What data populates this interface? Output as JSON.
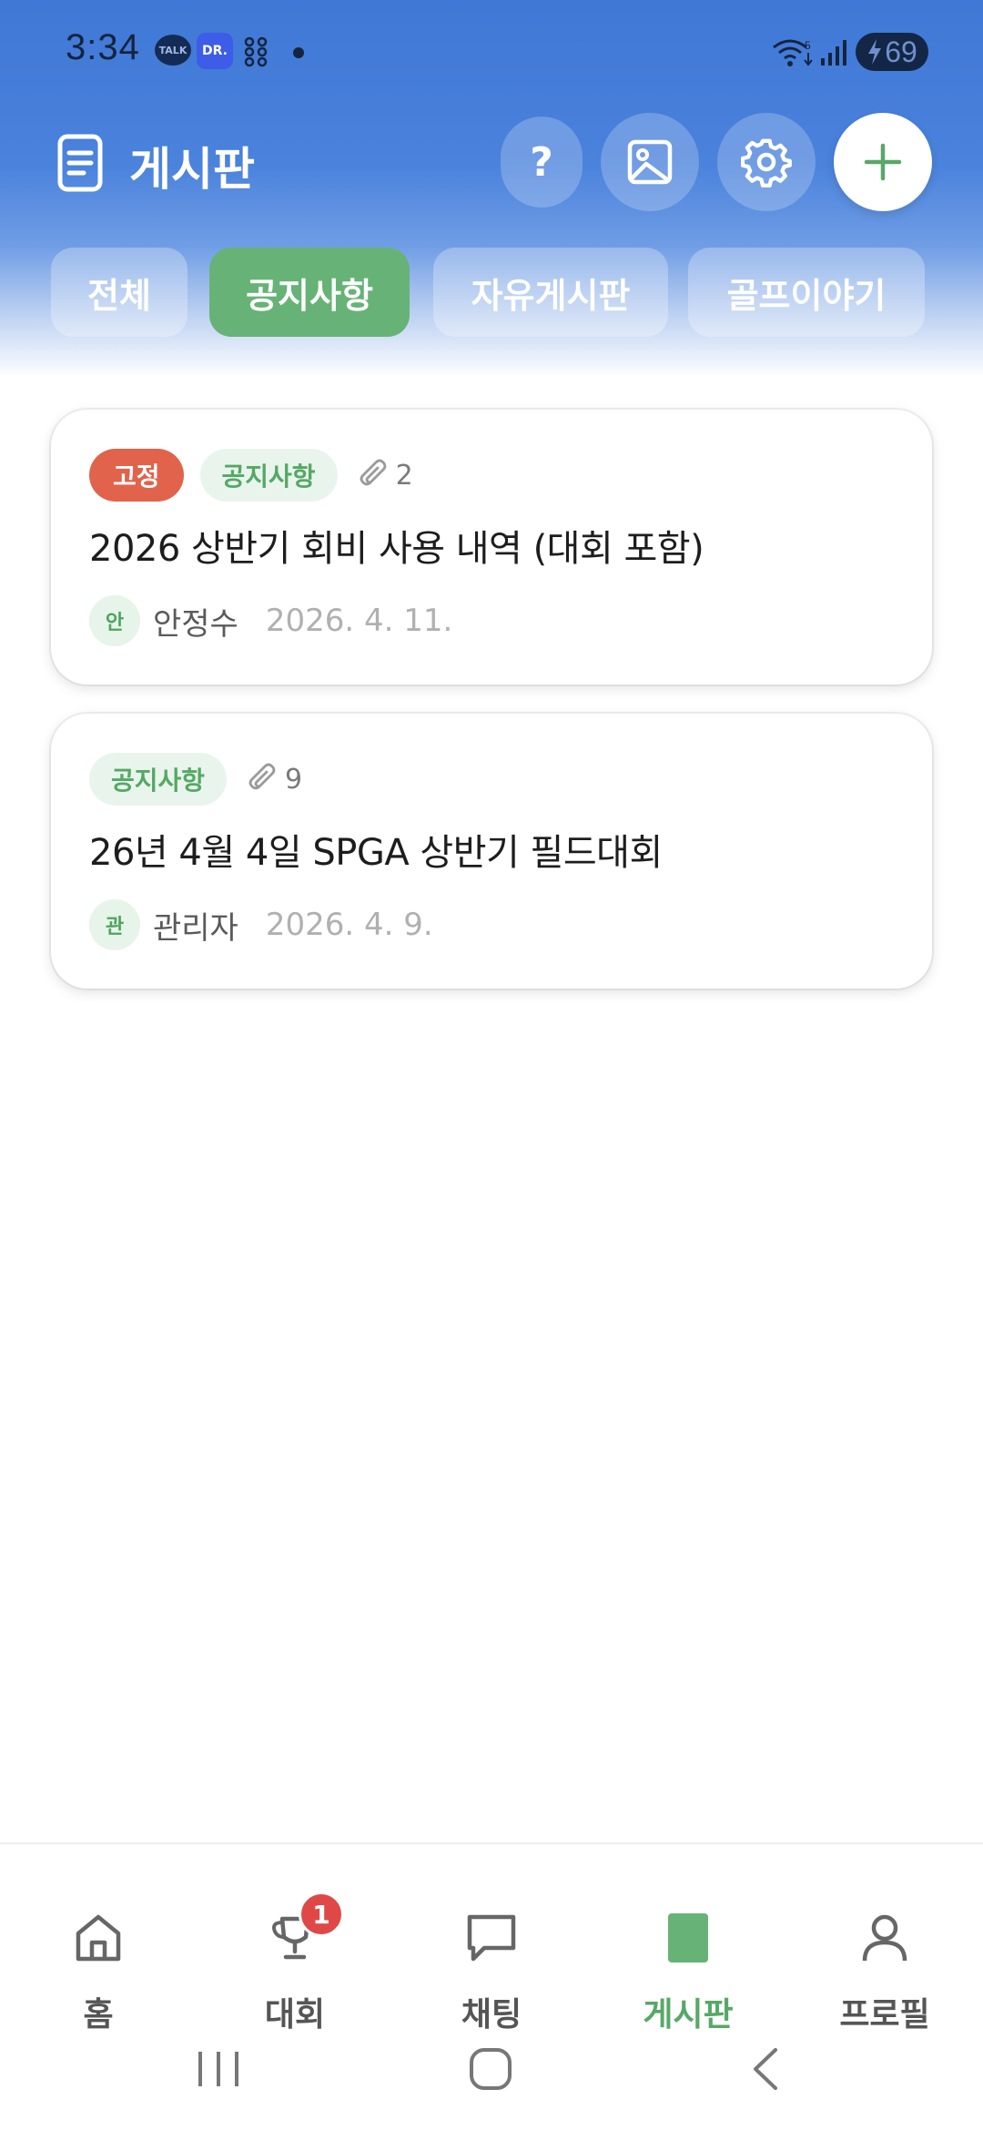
{
  "status_bar": {
    "time": "3:34",
    "talk_icon_text": "TALK",
    "dr_icon_text": "DR.",
    "battery_level": "69"
  },
  "header": {
    "title": "게시판",
    "help_label": "?"
  },
  "tabs": [
    {
      "label": "전체",
      "active": false
    },
    {
      "label": "공지사항",
      "active": true
    },
    {
      "label": "자유게시판",
      "active": false
    },
    {
      "label": "골프이야기",
      "active": false
    }
  ],
  "posts": [
    {
      "pinned_label": "고정",
      "category": "공지사항",
      "attachments": "2",
      "title": "2026 상반기 회비 사용 내역 (대회 포함)",
      "avatar": "안",
      "author": "안정수",
      "date": "2026. 4. 11."
    },
    {
      "category": "공지사항",
      "attachments": "9",
      "title": "26년 4월 4일 SPGA 상반기 필드대회",
      "avatar": "관",
      "author": "관리자",
      "date": "2026. 4. 9."
    }
  ],
  "bottom_nav": {
    "items": [
      {
        "label": "홈",
        "icon": "home-icon"
      },
      {
        "label": "대회",
        "icon": "trophy-icon",
        "badge": "1"
      },
      {
        "label": "채팅",
        "icon": "chat-icon"
      },
      {
        "label": "게시판",
        "icon": "board-icon",
        "active": true
      },
      {
        "label": "프로필",
        "icon": "profile-icon"
      }
    ]
  },
  "colors": {
    "header_blue": "#3f78d6",
    "accent_green": "#67b377",
    "pin_red": "#e1634b",
    "badge_red": "#e04848"
  }
}
